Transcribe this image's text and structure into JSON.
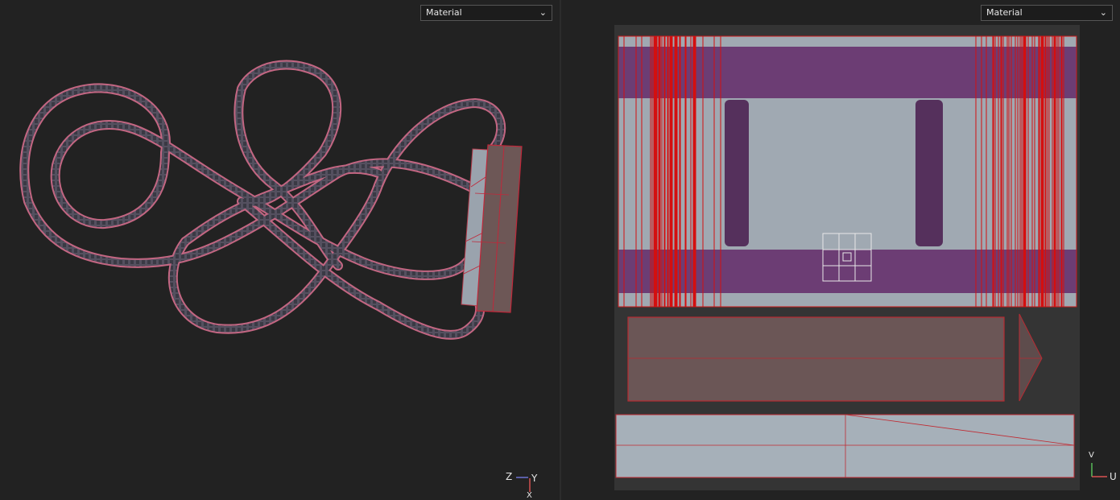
{
  "left_viewport": {
    "material_select": "Material",
    "axis_gizmo": {
      "z": "Z",
      "y": "Y",
      "x": "X"
    }
  },
  "right_viewport": {
    "material_select": "Material",
    "axis_gizmo": {
      "v": "V",
      "u": "U"
    }
  },
  "colors": {
    "background": "#222222",
    "track": "#c56a86",
    "uv_red": "#d01010",
    "purple": "#6a3a72",
    "grey": "#a2acb5",
    "rust": "#6e5656"
  },
  "icons": [
    "chevron-down-icon",
    "axis-gizmo-icon"
  ]
}
